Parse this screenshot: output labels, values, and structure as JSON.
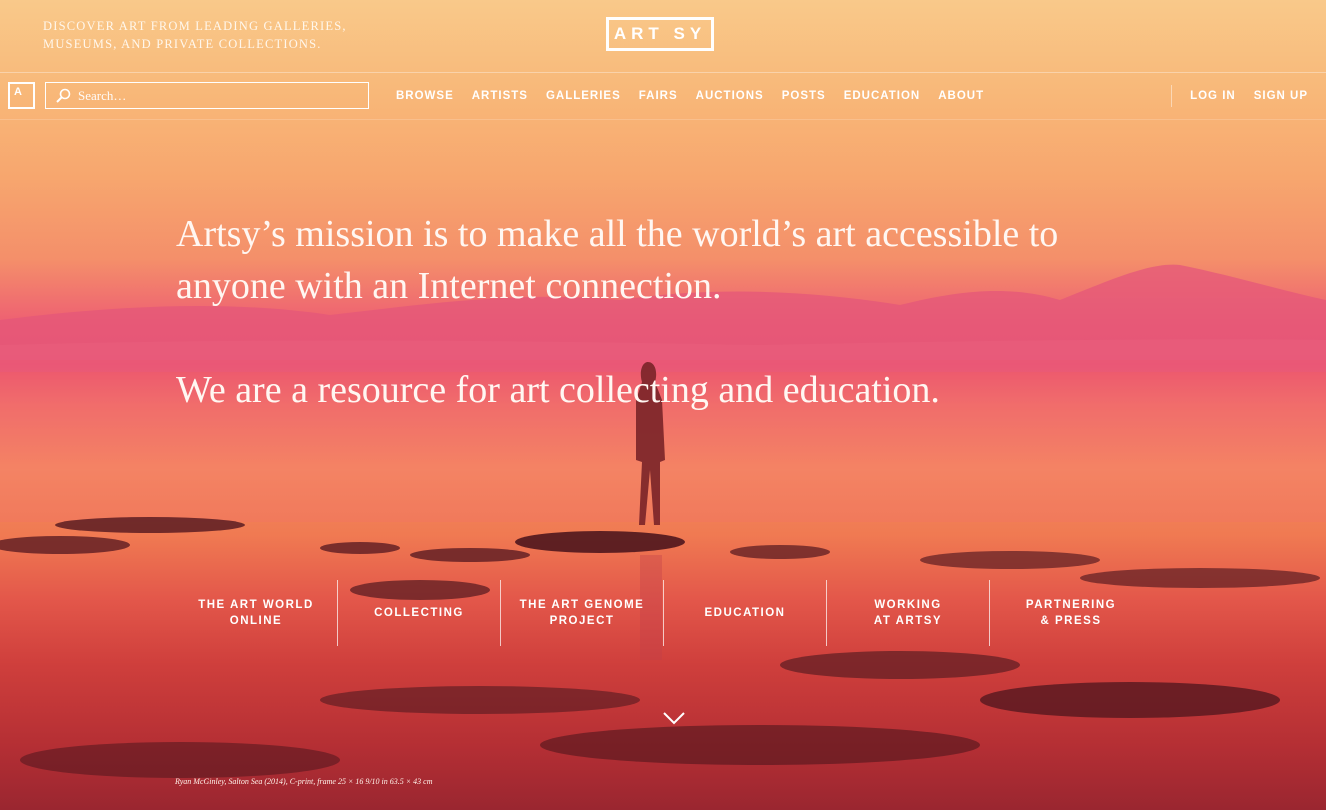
{
  "header": {
    "tagline": "Discover art from leading galleries, museums, and private collections.",
    "logo_text": "ART SY"
  },
  "navbar": {
    "mini_logo": "A",
    "search": {
      "placeholder": "Search…"
    },
    "links": [
      "BROWSE",
      "ARTISTS",
      "GALLERIES",
      "FAIRS",
      "AUCTIONS",
      "POSTS",
      "EDUCATION",
      "ABOUT"
    ],
    "auth": {
      "login": "LOG IN",
      "signup": "SIGN UP"
    }
  },
  "hero": {
    "mission": "Artsy’s mission is to make all the world’s art accessible to anyone with an Internet connection.",
    "resource": "We are a resource for art collecting and education."
  },
  "sections": [
    "THE ART WORLD\nONLINE",
    "COLLECTING",
    "THE ART GENOME\nPROJECT",
    "EDUCATION",
    "WORKING\nAT ARTSY",
    "PARTNERING\n& PRESS"
  ],
  "caption": "Ryan McGinley, Salton Sea (2014), C-print, frame 25 × 16 9/10 in 63.5 × 43 cm",
  "icons": {
    "search": "search-icon",
    "scroll": "chevron-down-icon"
  },
  "colors": {
    "sky_top": "#f9c98a",
    "horizon": "#ea4f6e",
    "ground": "#9a2630"
  }
}
